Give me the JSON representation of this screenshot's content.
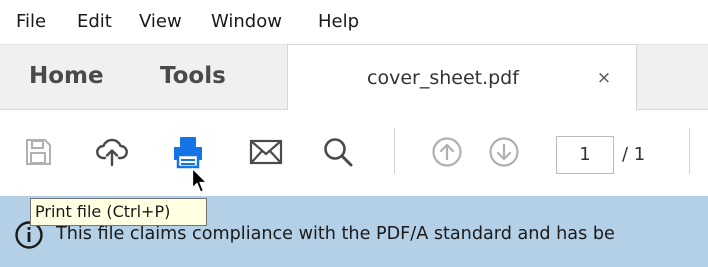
{
  "menu": {
    "items": [
      "File",
      "Edit",
      "View",
      "Window",
      "Help"
    ]
  },
  "tabs": {
    "home": "Home",
    "tools": "Tools",
    "document": {
      "label": "cover_sheet.pdf",
      "close": "×"
    }
  },
  "toolbar": {
    "icons": [
      "save-icon",
      "cloud-upload-icon",
      "print-icon",
      "mail-icon",
      "search-icon",
      "page-up-icon",
      "page-down-icon"
    ],
    "page_number": "1",
    "page_total": "/ 1",
    "print_accent_color": "#1473e6",
    "icon_color": "#5c5c5c"
  },
  "tooltip": {
    "text": "Print file (Ctrl+P)"
  },
  "info_bar": {
    "text": "This file claims compliance with the PDF/A standard and has be",
    "background": "#b4d0e6"
  }
}
